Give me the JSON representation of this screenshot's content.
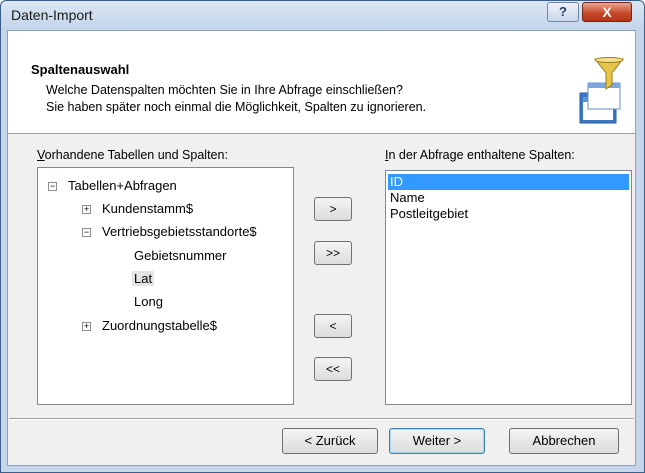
{
  "window": {
    "title": "Daten-Import",
    "help_label": "?",
    "close_label": "X"
  },
  "header": {
    "title": "Spaltenauswahl",
    "line1": "Welche Datenspalten möchten Sie in Ihre Abfrage einschließen?",
    "line2": "Sie haben später noch einmal die Möglichkeit, Spalten zu ignorieren.",
    "icon": "funnel-table-icon"
  },
  "left_panel": {
    "label": "Vorhandene Tabellen und Spalten:",
    "tree": {
      "root": "Tabellen+Abfragen",
      "items": [
        "Kundenstamm$",
        "Vertriebsgebietsstandorte$",
        "Gebietsnummer",
        "Lat",
        "Long",
        "Zuordnungstabelle$"
      ],
      "expand_symbol": "+",
      "collapse_symbol": "−",
      "selected": "Lat"
    }
  },
  "arrow_buttons": {
    "add_one": ">",
    "add_all": ">>",
    "remove_one": "<",
    "remove_all": "<<"
  },
  "right_panel": {
    "label": "In der Abfrage enthaltene Spalten:",
    "items": [
      "ID",
      "Name",
      "Postleitgebiet"
    ],
    "selected": "ID"
  },
  "footer": {
    "back": "< Zurück",
    "next": "Weiter >",
    "cancel": "Abbrechen"
  },
  "colors": {
    "selection": "#3399ff",
    "close_button": "#c74a2b",
    "title_bar": "#c2d4ea"
  }
}
